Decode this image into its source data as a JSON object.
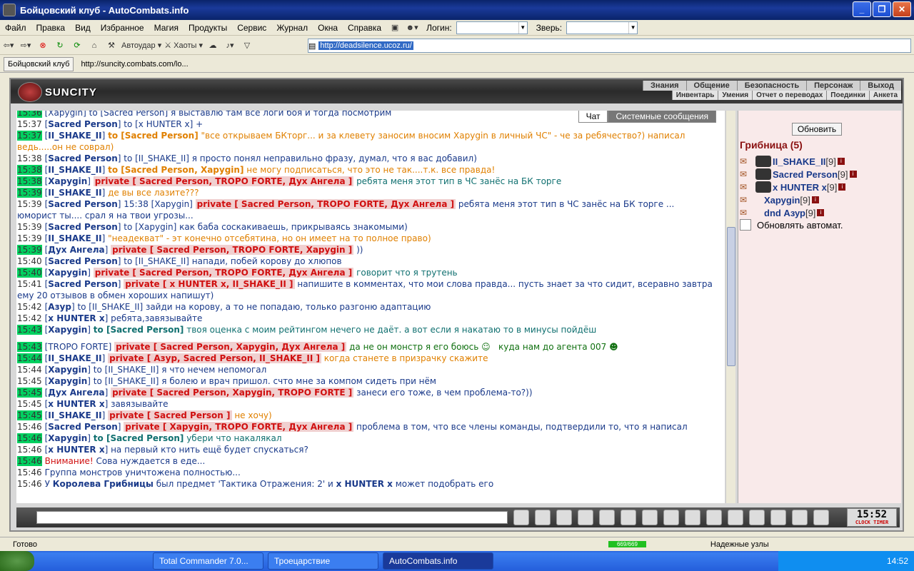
{
  "window": {
    "title": "Бойцовский клуб - AutoCombats.info"
  },
  "menu": [
    "Файл",
    "Правка",
    "Вид",
    "Избранное",
    "Магия",
    "Продукты",
    "Сервис",
    "Журнал",
    "Окна",
    "Справка"
  ],
  "login_label": "Логин:",
  "beast_label": "Зверь:",
  "toolbar": {
    "autoudar": "Автоудар",
    "haoty": "Хаоты",
    "address": "http://deadsilence.ucoz.ru/"
  },
  "tabs": [
    "Бойцовский клуб",
    "http://suncity.combats.com/lo..."
  ],
  "site": {
    "logo": "SUNCITY",
    "top_links": [
      "Знания",
      "Общение",
      "Безопасность",
      "Персонаж",
      "Выход"
    ],
    "sub_links": [
      "Инвентарь",
      "Умения",
      "Отчет о переводах",
      "Поединки",
      "Анкета"
    ]
  },
  "chat_tabs": [
    "Чат",
    "Системные сообщения"
  ],
  "chat_lines": [
    {
      "ts": "15:36",
      "hl": true,
      "html": "[Харуgin] to [Sacred Person] я выставлю там все логи боя и тогда посмотрим"
    },
    {
      "ts": "15:37",
      "hl": false,
      "html": "[<b>Sacred Person</b>] to [x HUNTER x] +"
    },
    {
      "ts": "15:37",
      "hl": true,
      "html": "[<b>II_SHAKE_II</b>] <span style='color:#e08000'><b>to [Sacred Person]</b> \"все открываем БКторг... и за клевету заносим вносим Харуgin в личный ЧС\" - че за ребячество?) написал ведь.....он не соврал)</span>"
    },
    {
      "ts": "15:38",
      "hl": false,
      "html": "[<b>Sacred Person</b>] to [II_SHAKE_II] я просто понял неправильно фразу, думал, что я вас добавил)"
    },
    {
      "ts": "15:38",
      "hl": true,
      "html": "[<b>II_SHAKE_II</b>] <span style='color:#e08000'><b>to [Sacred Person, Харуgin]</b> не могу подписаться, что это не так....т.к. все правда!</span>"
    },
    {
      "ts": "15:38",
      "hl": true,
      "html": "[<b>Харуgin</b>] <span class='priv'>private [ Sacred Person, TROPO FORTE, Дух Ангела ]</span> <span style='color:#107070'>ребята меня этот тип в ЧС занёс на БК торге</span>"
    },
    {
      "ts": "15:39",
      "hl": true,
      "html": "[<b>II_SHAKE_II</b>] <span style='color:#e08000'>де вы все лазите???</span>"
    },
    {
      "ts": "15:39",
      "hl": false,
      "html": "[<b>Sacred Person</b>] 15:38 [Харуgin] <span class='priv'>private [ Sacred Person, TROPO FORTE, Дух Ангела ]</span> ребята меня этот тип в ЧС занёс на БК торге ... юморист ты.... срал я на твои угрозы..."
    },
    {
      "ts": "15:39",
      "hl": false,
      "html": "[<b>Sacred Person</b>] to [Харуgin] как баба соскакиваешь, прикрываясь знакомыми)"
    },
    {
      "ts": "15:39",
      "hl": false,
      "html": "[<b>II_SHAKE_II</b>] <span style='color:#e08000'>\"неадекват\" - эт конечно отсебятина, но он имеет на то полное право)</span>"
    },
    {
      "ts": "15:39",
      "hl": true,
      "html": "[<b>Дух Ангела</b>] <span class='priv'>private [ Sacred Person, TROPO FORTE, Харуgin ]</span> <span style='color:#1a3a8a'>))</span>"
    },
    {
      "ts": "15:40",
      "hl": false,
      "html": "[<b>Sacred Person</b>] to [II_SHAKE_II] напади, побей корову до хлюпов"
    },
    {
      "ts": "15:40",
      "hl": true,
      "html": "[<b>Харуgin</b>] <span class='priv'>private [ Sacred Person, TROPO FORTE, Дух Ангела ]</span> <span style='color:#107070'>говорит что я трутень</span>"
    },
    {
      "ts": "15:41",
      "hl": false,
      "html": "[<b>Sacred Person</b>] <span class='priv'>private [ x HUNTER x, II_SHAKE_II ]</span> напишите в комментах, что мои слова правда... пусть знает за что сидит, всеравно завтра ему 20 отзывов в обмен хороших напишут)"
    },
    {
      "ts": "15:42",
      "hl": false,
      "html": "[<b>Азур</b>] to [II_SHAKE_II] зайди на корову, а то не попадаю, только разгоню адаптацию"
    },
    {
      "ts": "15:42",
      "hl": false,
      "html": "[<b>x HUNTER x</b>] ребята,завязывайте"
    },
    {
      "ts": "15:43",
      "hl": true,
      "html": "[<b>Харуgin</b>] <span style='color:#107070'><b>to [Sacred Person]</b> твоя оценка с моим рейтингом нечего не даёт. а вот если я накатаю то в минусы пойдёш</span>"
    },
    {
      "gap": true
    },
    {
      "ts": "15:43",
      "hl": true,
      "html": "[TROPO FORTE] <span class='priv'>private [ Sacred Person, Харуgin, Дух Ангела ]</span> <span style='color:#107010'>да не он монстр я его боюсь ☺ &nbsp;&nbsp;куда нам до агента 007 ☻</span>"
    },
    {
      "ts": "15:44",
      "hl": true,
      "html": "[<b>II_SHAKE_II</b>] <span class='priv'>private [ Азур, Sacred Person, II_SHAKE_II ]</span> <span style='color:#e08000'>когда станете в призрачку скажите</span>"
    },
    {
      "ts": "15:44",
      "hl": false,
      "html": "[<b>Харуgin</b>] to [II_SHAKE_II] я что нечем непомогал"
    },
    {
      "ts": "15:45",
      "hl": false,
      "html": "[<b>Харуgin</b>] to [II_SHAKE_II] я болею и врач пришол. счто мне за компом сидеть при нём"
    },
    {
      "ts": "15:45",
      "hl": true,
      "html": "[<b>Дух Ангела</b>] <span class='priv'>private [ Sacred Person, Харуgin, TROPO FORTE ]</span> <span style='color:#1a3a8a'>занеси его тоже, в чем проблема-то?))</span>"
    },
    {
      "ts": "15:45",
      "hl": false,
      "html": "[<b>x HUNTER x</b>] завязывайте"
    },
    {
      "ts": "15:45",
      "hl": true,
      "html": "[<b>II_SHAKE_II</b>] <span class='priv'>private [ Sacred Person ]</span> <span style='color:#e08000'>не хочу)</span>"
    },
    {
      "ts": "15:46",
      "hl": false,
      "html": "[<b>Sacred Person</b>] <span class='priv'>private [ Харуgin, TROPO FORTE, Дух Ангела ]</span> проблема в том, что все члены команды, подтвердили то, что я написал"
    },
    {
      "ts": "15:46",
      "hl": true,
      "html": "[<b>Харуgin</b>] <span style='color:#107070'><b>to [Sacred Person]</b> убери что накалякал</span>"
    },
    {
      "ts": "15:46",
      "hl": false,
      "html": "[<b>x HUNTER x</b>] на первый кто нить ещё будет спускаться?"
    },
    {
      "ts": "15:46",
      "hl": true,
      "html": "<span style='color:#d01010'>Внимание!</span> Сова нуждается в еде..."
    },
    {
      "ts": "15:46",
      "hl": false,
      "html": "Группа монстров уничтожена полностью..."
    },
    {
      "ts": "15:46",
      "hl": false,
      "html": "У <b>Королева Грибницы</b> был предмет 'Тактика Отражения: 2' и <b>x HUNTER x</b> может подобрать его"
    }
  ],
  "side": {
    "refresh": "Обновить",
    "room": "Грибница (5)",
    "users": [
      {
        "name": "II_SHAKE_II",
        "lvl": "[9]",
        "av": true
      },
      {
        "name": "Sacred Person",
        "lvl": "[9]",
        "av": true
      },
      {
        "name": "x HUNTER x",
        "lvl": "[9]",
        "av": true
      },
      {
        "name": "Харуgin",
        "lvl": "[9]",
        "av": false
      },
      {
        "name": "dnd Азур",
        "lvl": "[9]",
        "av": false
      }
    ],
    "autorefresh": "Обновлять автомат."
  },
  "clock": {
    "time": "15:52",
    "sub": "CLOCK TIMER"
  },
  "status": {
    "text": "Готово",
    "progress": "669/669",
    "secure": "Надежные узлы"
  },
  "taskbar": {
    "tasks": [
      "Total Commander 7.0...",
      "Троецарствие",
      "AutoCombats.info"
    ],
    "time": "14:52"
  }
}
